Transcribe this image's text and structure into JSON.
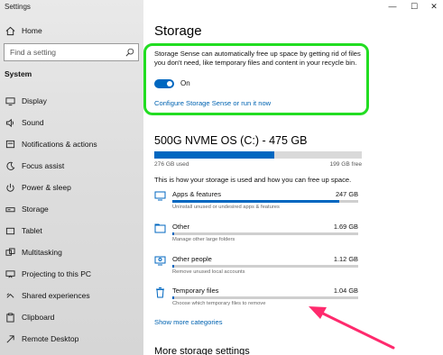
{
  "window": {
    "title": "Settings",
    "controls": {
      "minimize": "—",
      "maximize": "☐",
      "close": "✕"
    }
  },
  "sidebar": {
    "home_label": "Home",
    "search_placeholder": "Find a setting",
    "section_title": "System",
    "items": [
      {
        "label": "Display",
        "icon": "display-icon"
      },
      {
        "label": "Sound",
        "icon": "sound-icon"
      },
      {
        "label": "Notifications & actions",
        "icon": "notifications-icon"
      },
      {
        "label": "Focus assist",
        "icon": "focus-assist-icon"
      },
      {
        "label": "Power & sleep",
        "icon": "power-icon"
      },
      {
        "label": "Storage",
        "icon": "storage-icon"
      },
      {
        "label": "Tablet",
        "icon": "tablet-icon"
      },
      {
        "label": "Multitasking",
        "icon": "multitasking-icon"
      },
      {
        "label": "Projecting to this PC",
        "icon": "projecting-icon"
      },
      {
        "label": "Shared experiences",
        "icon": "shared-experiences-icon"
      },
      {
        "label": "Clipboard",
        "icon": "clipboard-icon"
      },
      {
        "label": "Remote Desktop",
        "icon": "remote-desktop-icon"
      }
    ]
  },
  "main": {
    "title": "Storage",
    "storage_sense": {
      "description": "Storage Sense can automatically free up space by getting rid of files you don't need, like temporary files and content in your recycle bin.",
      "toggle_state": "On",
      "toggle_on": true,
      "configure_link": "Configure Storage Sense or run it now",
      "highlight_color": "#22dd22"
    },
    "drive": {
      "title": "500G NVME OS (C:) - 475 GB",
      "used_label": "276 GB used",
      "free_label": "199 GB free",
      "used_fraction": 0.58,
      "description": "This is how your storage is used and how you can free up space."
    },
    "categories": [
      {
        "name": "Apps & features",
        "size": "247 GB",
        "desc": "Uninstall unused or undesired apps & features",
        "fraction": 0.9,
        "icon": "apps-icon"
      },
      {
        "name": "Other",
        "size": "1.69 GB",
        "desc": "Manage other large folders",
        "fraction": 0.01,
        "icon": "other-icon"
      },
      {
        "name": "Other people",
        "size": "1.12 GB",
        "desc": "Remove unused local accounts",
        "fraction": 0.008,
        "icon": "other-people-icon"
      },
      {
        "name": "Temporary files",
        "size": "1.04 GB",
        "desc": "Choose which temporary files to remove",
        "fraction": 0.007,
        "icon": "trash-icon"
      }
    ],
    "show_more": "Show more categories",
    "more_settings_title": "More storage settings"
  },
  "accent": "#0067c0",
  "annotation_arrow_color": "#ff2a6d"
}
